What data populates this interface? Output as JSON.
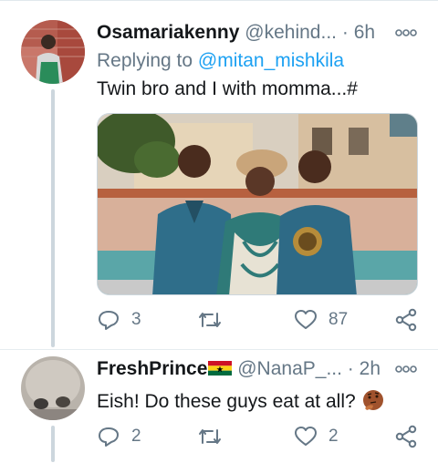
{
  "tweets": [
    {
      "name": "Osamariakenny",
      "handle": "@kehind...",
      "dot": "·",
      "time": "6h",
      "reply_prefix": "Replying to ",
      "reply_mention": "@mitan_mishkila",
      "text": "Twin bro and I with momma...#",
      "has_photo": true,
      "replies": "3",
      "retweets": "",
      "likes": "87"
    },
    {
      "name": "FreshPrince",
      "flag_icon": "ghana-flag",
      "handle": "@NanaP_...",
      "dot": "·",
      "time": "2h",
      "text": "Eish! Do these guys eat at all?",
      "emoji_icon": "thinking-face-emoji",
      "replies": "2",
      "retweets": "",
      "likes": "2"
    }
  ],
  "colors": {
    "accent": "#1da1f2",
    "muted": "#657786",
    "text": "#14171a",
    "divider": "#e6ecf0"
  }
}
